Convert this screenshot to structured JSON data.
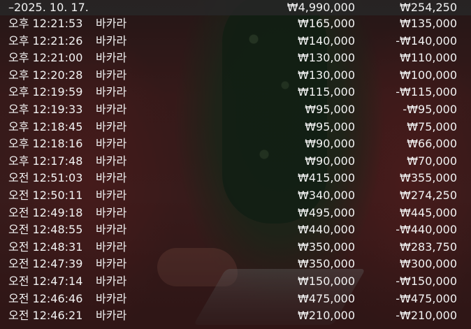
{
  "summary": {
    "date": "–2025. 10. 17.",
    "total_bet": "₩4,990,000",
    "total_result": "₩254,250"
  },
  "rows": [
    {
      "time": "오후 12:21:53",
      "game": "바카라",
      "bet": "₩165,000",
      "result": "₩135,000"
    },
    {
      "time": "오후 12:21:26",
      "game": "바카라",
      "bet": "₩140,000",
      "result": "-₩140,000"
    },
    {
      "time": "오후 12:21:00",
      "game": "바카라",
      "bet": "₩130,000",
      "result": "₩110,000"
    },
    {
      "time": "오후 12:20:28",
      "game": "바카라",
      "bet": "₩130,000",
      "result": "₩100,000"
    },
    {
      "time": "오후 12:19:59",
      "game": "바카라",
      "bet": "₩115,000",
      "result": "-₩115,000"
    },
    {
      "time": "오후 12:19:33",
      "game": "바카라",
      "bet": "₩95,000",
      "result": "-₩95,000"
    },
    {
      "time": "오후 12:18:45",
      "game": "바카라",
      "bet": "₩95,000",
      "result": "₩75,000"
    },
    {
      "time": "오후 12:18:16",
      "game": "바카라",
      "bet": "₩90,000",
      "result": "₩66,000"
    },
    {
      "time": "오후 12:17:48",
      "game": "바카라",
      "bet": "₩90,000",
      "result": "₩70,000"
    },
    {
      "time": "오전 12:51:03",
      "game": "바카라",
      "bet": "₩415,000",
      "result": "₩355,000"
    },
    {
      "time": "오전 12:50:11",
      "game": "바카라",
      "bet": "₩340,000",
      "result": "₩274,250"
    },
    {
      "time": "오전 12:49:18",
      "game": "바카라",
      "bet": "₩495,000",
      "result": "₩445,000"
    },
    {
      "time": "오전 12:48:55",
      "game": "바카라",
      "bet": "₩440,000",
      "result": "-₩440,000"
    },
    {
      "time": "오전 12:48:31",
      "game": "바카라",
      "bet": "₩350,000",
      "result": "₩283,750"
    },
    {
      "time": "오전 12:47:39",
      "game": "바카라",
      "bet": "₩350,000",
      "result": "₩300,000"
    },
    {
      "time": "오전 12:47:14",
      "game": "바카라",
      "bet": "₩150,000",
      "result": "-₩150,000"
    },
    {
      "time": "오전 12:46:46",
      "game": "바카라",
      "bet": "₩475,000",
      "result": "-₩475,000"
    },
    {
      "time": "오전 12:46:21",
      "game": "바카라",
      "bet": "₩210,000",
      "result": "-₩210,000"
    }
  ]
}
